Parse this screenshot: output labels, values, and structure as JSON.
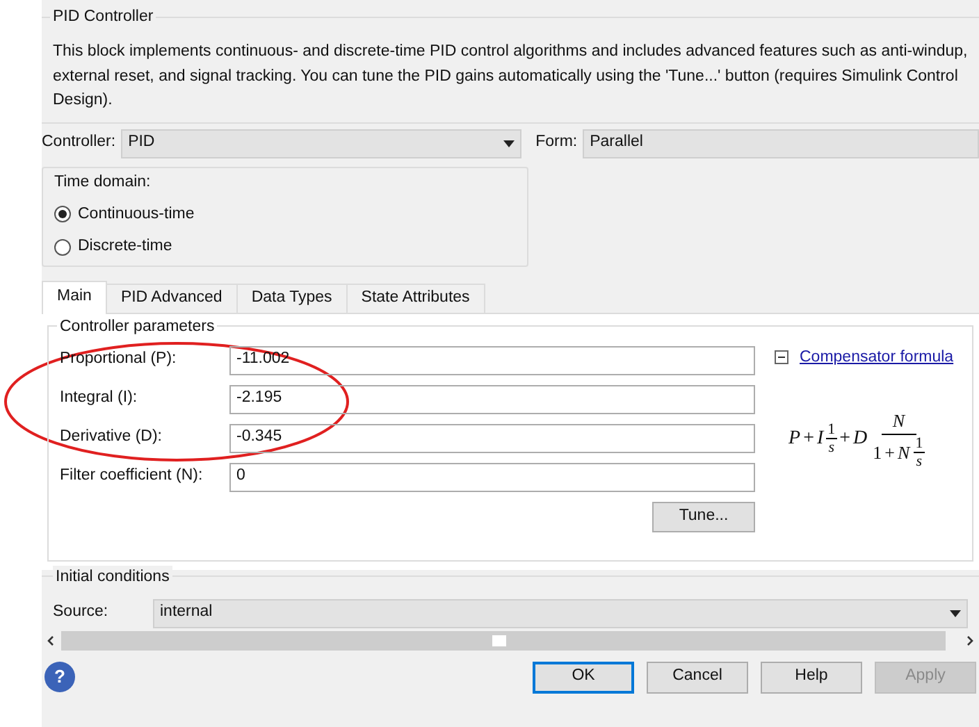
{
  "group_title": "PID Controller",
  "description": "This block implements continuous- and discrete-time PID control algorithms and includes advanced features such as anti-windup, external reset, and signal tracking. You can tune the PID gains automatically using the 'Tune...' button (requires Simulink Control Design).",
  "controller": {
    "label": "Controller:",
    "value": "PID"
  },
  "form": {
    "label": "Form:",
    "value": "Parallel"
  },
  "time_domain": {
    "title": "Time domain:",
    "options": [
      {
        "label": "Continuous-time",
        "selected": true
      },
      {
        "label": "Discrete-time",
        "selected": false
      }
    ]
  },
  "tabs": [
    {
      "label": "Main",
      "selected": true
    },
    {
      "label": "PID Advanced",
      "selected": false
    },
    {
      "label": "Data Types",
      "selected": false
    },
    {
      "label": "State Attributes",
      "selected": false
    }
  ],
  "parameters": {
    "title": "Controller parameters",
    "fields": [
      {
        "label": "Proportional (P):",
        "value": "-11.002"
      },
      {
        "label": "Integral (I):",
        "value": "-2.195"
      },
      {
        "label": "Derivative (D):",
        "value": "-0.345"
      },
      {
        "label": "Filter coefficient (N):",
        "value": "0"
      }
    ],
    "tune": "Tune...",
    "expanded": true,
    "link": "Compensator formula",
    "formula": {
      "p": "P",
      "plus_1": "+",
      "i": "I",
      "i_num": "1",
      "i_den": "s",
      "plus_2": "+",
      "d": "D",
      "numerator": "N",
      "den_one": "1",
      "plus_3": "+",
      "den_n": "N",
      "den_num": "1",
      "den_den": "s"
    }
  },
  "initial": {
    "title": "Initial conditions",
    "label": "Source:",
    "value": "internal"
  },
  "buttons": [
    {
      "label": "OK",
      "disabled": false,
      "default": true
    },
    {
      "label": "Cancel",
      "disabled": false,
      "default": false
    },
    {
      "label": "Help",
      "disabled": false,
      "default": false
    },
    {
      "label": "Apply",
      "disabled": true,
      "default": false
    }
  ],
  "help_icon": "?"
}
